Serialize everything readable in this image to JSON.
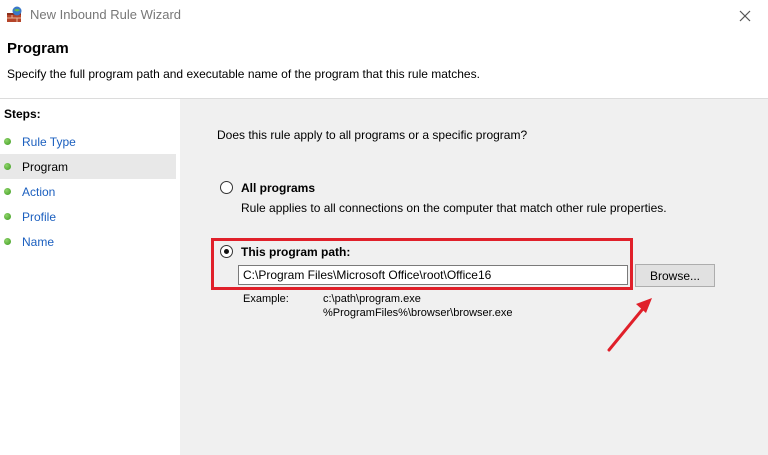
{
  "window": {
    "title": "New Inbound Rule Wizard",
    "icons": {
      "app": "firewall-wizard-icon",
      "close": "close-icon"
    }
  },
  "header": {
    "title": "Program",
    "description": "Specify the full program path and executable name of the program that this rule matches."
  },
  "steps": {
    "header": "Steps:",
    "items": [
      {
        "label": "Rule Type",
        "current": false
      },
      {
        "label": "Program",
        "current": true
      },
      {
        "label": "Action",
        "current": false
      },
      {
        "label": "Profile",
        "current": false
      },
      {
        "label": "Name",
        "current": false
      }
    ]
  },
  "main": {
    "question": "Does this rule apply to all programs or a specific program?",
    "all_programs": {
      "label": "All programs",
      "description": "Rule applies to all connections on the computer that match other rule properties.",
      "selected": false
    },
    "program_path": {
      "label": "This program path:",
      "value": "C:\\Program Files\\Microsoft Office\\root\\Office16",
      "selected": true
    },
    "browse_label": "Browse...",
    "example_label": "Example:",
    "example_lines": [
      "c:\\path\\program.exe",
      "%ProgramFiles%\\browser\\browser.exe"
    ]
  },
  "annotation": {
    "highlight_color": "#e0202a"
  }
}
